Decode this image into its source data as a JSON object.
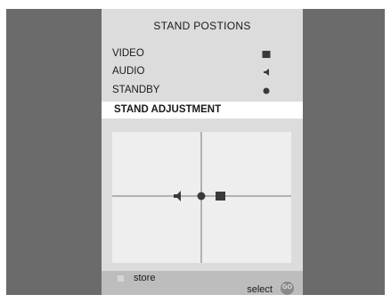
{
  "menu": {
    "title": "STAND POSTIONS",
    "items": [
      {
        "label": "VIDEO",
        "icon": "square-icon"
      },
      {
        "label": "AUDIO",
        "icon": "speaker-icon"
      },
      {
        "label": "STANDBY",
        "icon": "dot-icon"
      }
    ],
    "adjustment_label": "STAND ADJUSTMENT"
  },
  "stand_plot": {
    "markers": [
      "speaker-icon",
      "dot-icon",
      "square-icon"
    ]
  },
  "footer": {
    "store_label": "store",
    "select_label": "select",
    "go_label": "GO"
  },
  "colors": {
    "frame": "#6b6b6b",
    "menu_background": "#dcdcdc",
    "highlight": "#ffffff",
    "plot_background": "#eeeeee",
    "bottom_bar": "#bdbdbd"
  }
}
